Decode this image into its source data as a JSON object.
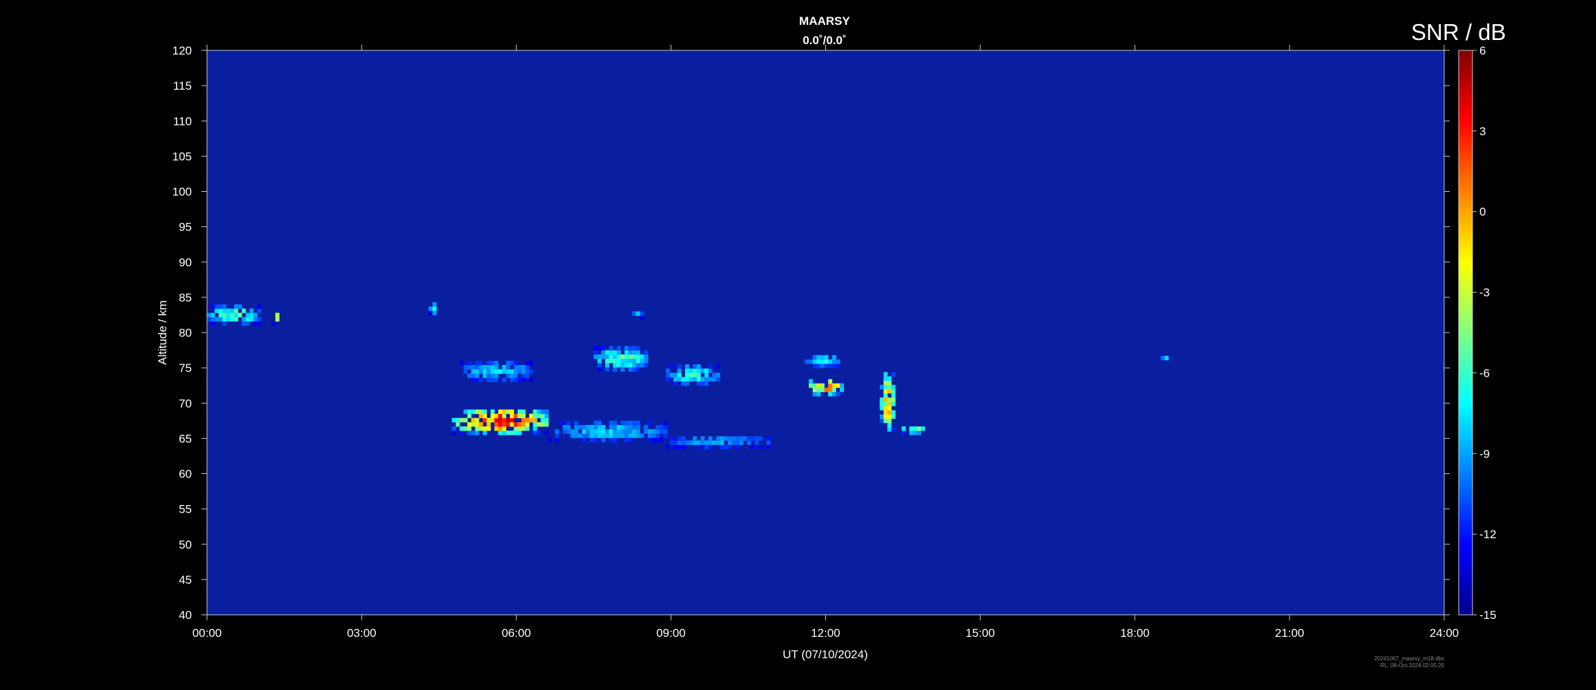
{
  "chart_data": {
    "type": "heatmap",
    "title": "MAARSY",
    "subtitle": "0.0˚/0.0˚",
    "xlabel": "UT (07/10/2024)",
    "ylabel": "Altitude / km",
    "x_ticks": [
      "00:00",
      "03:00",
      "06:00",
      "09:00",
      "12:00",
      "15:00",
      "18:00",
      "21:00",
      "24:00"
    ],
    "y_ticks": [
      40,
      45,
      50,
      55,
      60,
      65,
      70,
      75,
      80,
      85,
      90,
      95,
      100,
      105,
      110,
      115,
      120
    ],
    "xlim_hours": [
      0,
      24
    ],
    "ylim_km": [
      40,
      120
    ],
    "colorbar": {
      "label": "SNR / dB",
      "range": [
        -15,
        6
      ],
      "ticks": [
        6,
        3,
        0,
        -3,
        -6,
        -9,
        -12,
        -15
      ],
      "colormap": "jet"
    },
    "background_snr_db": -13,
    "echo_regions": [
      {
        "t_start": 4.75,
        "t_end": 6.6,
        "alt_low": 65.5,
        "alt_high": 69.0,
        "peak_snr_db": 5
      },
      {
        "t_start": 6.6,
        "t_end": 8.9,
        "alt_low": 64.5,
        "alt_high": 67.0,
        "peak_snr_db": -7
      },
      {
        "t_start": 8.9,
        "t_end": 10.9,
        "alt_low": 63.5,
        "alt_high": 65.0,
        "peak_snr_db": -8
      },
      {
        "t_start": 4.9,
        "t_end": 6.3,
        "alt_low": 73.0,
        "alt_high": 75.5,
        "peak_snr_db": -7
      },
      {
        "t_start": 7.5,
        "t_end": 8.5,
        "alt_low": 74.5,
        "alt_high": 77.5,
        "peak_snr_db": -4
      },
      {
        "t_start": 8.9,
        "t_end": 9.9,
        "alt_low": 72.5,
        "alt_high": 75.0,
        "peak_snr_db": -5
      },
      {
        "t_start": 11.6,
        "t_end": 12.3,
        "alt_low": 71.0,
        "alt_high": 73.0,
        "peak_snr_db": 3
      },
      {
        "t_start": 11.6,
        "t_end": 12.3,
        "alt_low": 75.0,
        "alt_high": 76.5,
        "peak_snr_db": -6
      },
      {
        "t_start": 13.05,
        "t_end": 13.3,
        "alt_low": 66.0,
        "alt_high": 74.0,
        "peak_snr_db": 2
      },
      {
        "t_start": 13.4,
        "t_end": 14.0,
        "alt_low": 65.5,
        "alt_high": 66.5,
        "peak_snr_db": -1
      },
      {
        "t_start": 0.0,
        "t_end": 1.0,
        "alt_low": 81.0,
        "alt_high": 83.5,
        "peak_snr_db": -4
      },
      {
        "t_start": 1.25,
        "t_end": 1.4,
        "alt_low": 81.0,
        "alt_high": 82.5,
        "peak_snr_db": 1
      },
      {
        "t_start": 4.3,
        "t_end": 4.45,
        "alt_low": 82.5,
        "alt_high": 83.8,
        "peak_snr_db": -3
      },
      {
        "t_start": 8.25,
        "t_end": 8.4,
        "alt_low": 81.8,
        "alt_high": 82.6,
        "peak_snr_db": -4
      },
      {
        "t_start": 18.5,
        "t_end": 18.6,
        "alt_low": 75.5,
        "alt_high": 76.3,
        "peak_snr_db": -1
      }
    ],
    "footer_lines": [
      "20241007_maarsy_m18.dbs",
      "RL, 08-Oct-2024 02:05:20"
    ]
  }
}
